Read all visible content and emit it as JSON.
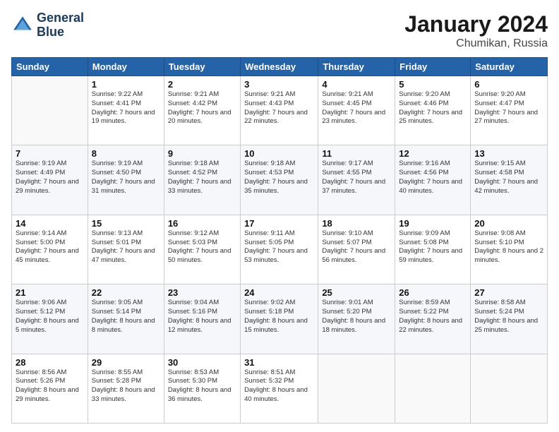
{
  "logo": {
    "line1": "General",
    "line2": "Blue"
  },
  "title": "January 2024",
  "subtitle": "Chumikan, Russia",
  "days_header": [
    "Sunday",
    "Monday",
    "Tuesday",
    "Wednesday",
    "Thursday",
    "Friday",
    "Saturday"
  ],
  "weeks": [
    [
      {
        "day": "",
        "sunrise": "",
        "sunset": "",
        "daylight": ""
      },
      {
        "day": "1",
        "sunrise": "Sunrise: 9:22 AM",
        "sunset": "Sunset: 4:41 PM",
        "daylight": "Daylight: 7 hours and 19 minutes."
      },
      {
        "day": "2",
        "sunrise": "Sunrise: 9:21 AM",
        "sunset": "Sunset: 4:42 PM",
        "daylight": "Daylight: 7 hours and 20 minutes."
      },
      {
        "day": "3",
        "sunrise": "Sunrise: 9:21 AM",
        "sunset": "Sunset: 4:43 PM",
        "daylight": "Daylight: 7 hours and 22 minutes."
      },
      {
        "day": "4",
        "sunrise": "Sunrise: 9:21 AM",
        "sunset": "Sunset: 4:45 PM",
        "daylight": "Daylight: 7 hours and 23 minutes."
      },
      {
        "day": "5",
        "sunrise": "Sunrise: 9:20 AM",
        "sunset": "Sunset: 4:46 PM",
        "daylight": "Daylight: 7 hours and 25 minutes."
      },
      {
        "day": "6",
        "sunrise": "Sunrise: 9:20 AM",
        "sunset": "Sunset: 4:47 PM",
        "daylight": "Daylight: 7 hours and 27 minutes."
      }
    ],
    [
      {
        "day": "7",
        "sunrise": "Sunrise: 9:19 AM",
        "sunset": "Sunset: 4:49 PM",
        "daylight": "Daylight: 7 hours and 29 minutes."
      },
      {
        "day": "8",
        "sunrise": "Sunrise: 9:19 AM",
        "sunset": "Sunset: 4:50 PM",
        "daylight": "Daylight: 7 hours and 31 minutes."
      },
      {
        "day": "9",
        "sunrise": "Sunrise: 9:18 AM",
        "sunset": "Sunset: 4:52 PM",
        "daylight": "Daylight: 7 hours and 33 minutes."
      },
      {
        "day": "10",
        "sunrise": "Sunrise: 9:18 AM",
        "sunset": "Sunset: 4:53 PM",
        "daylight": "Daylight: 7 hours and 35 minutes."
      },
      {
        "day": "11",
        "sunrise": "Sunrise: 9:17 AM",
        "sunset": "Sunset: 4:55 PM",
        "daylight": "Daylight: 7 hours and 37 minutes."
      },
      {
        "day": "12",
        "sunrise": "Sunrise: 9:16 AM",
        "sunset": "Sunset: 4:56 PM",
        "daylight": "Daylight: 7 hours and 40 minutes."
      },
      {
        "day": "13",
        "sunrise": "Sunrise: 9:15 AM",
        "sunset": "Sunset: 4:58 PM",
        "daylight": "Daylight: 7 hours and 42 minutes."
      }
    ],
    [
      {
        "day": "14",
        "sunrise": "Sunrise: 9:14 AM",
        "sunset": "Sunset: 5:00 PM",
        "daylight": "Daylight: 7 hours and 45 minutes."
      },
      {
        "day": "15",
        "sunrise": "Sunrise: 9:13 AM",
        "sunset": "Sunset: 5:01 PM",
        "daylight": "Daylight: 7 hours and 47 minutes."
      },
      {
        "day": "16",
        "sunrise": "Sunrise: 9:12 AM",
        "sunset": "Sunset: 5:03 PM",
        "daylight": "Daylight: 7 hours and 50 minutes."
      },
      {
        "day": "17",
        "sunrise": "Sunrise: 9:11 AM",
        "sunset": "Sunset: 5:05 PM",
        "daylight": "Daylight: 7 hours and 53 minutes."
      },
      {
        "day": "18",
        "sunrise": "Sunrise: 9:10 AM",
        "sunset": "Sunset: 5:07 PM",
        "daylight": "Daylight: 7 hours and 56 minutes."
      },
      {
        "day": "19",
        "sunrise": "Sunrise: 9:09 AM",
        "sunset": "Sunset: 5:08 PM",
        "daylight": "Daylight: 7 hours and 59 minutes."
      },
      {
        "day": "20",
        "sunrise": "Sunrise: 9:08 AM",
        "sunset": "Sunset: 5:10 PM",
        "daylight": "Daylight: 8 hours and 2 minutes."
      }
    ],
    [
      {
        "day": "21",
        "sunrise": "Sunrise: 9:06 AM",
        "sunset": "Sunset: 5:12 PM",
        "daylight": "Daylight: 8 hours and 5 minutes."
      },
      {
        "day": "22",
        "sunrise": "Sunrise: 9:05 AM",
        "sunset": "Sunset: 5:14 PM",
        "daylight": "Daylight: 8 hours and 8 minutes."
      },
      {
        "day": "23",
        "sunrise": "Sunrise: 9:04 AM",
        "sunset": "Sunset: 5:16 PM",
        "daylight": "Daylight: 8 hours and 12 minutes."
      },
      {
        "day": "24",
        "sunrise": "Sunrise: 9:02 AM",
        "sunset": "Sunset: 5:18 PM",
        "daylight": "Daylight: 8 hours and 15 minutes."
      },
      {
        "day": "25",
        "sunrise": "Sunrise: 9:01 AM",
        "sunset": "Sunset: 5:20 PM",
        "daylight": "Daylight: 8 hours and 18 minutes."
      },
      {
        "day": "26",
        "sunrise": "Sunrise: 8:59 AM",
        "sunset": "Sunset: 5:22 PM",
        "daylight": "Daylight: 8 hours and 22 minutes."
      },
      {
        "day": "27",
        "sunrise": "Sunrise: 8:58 AM",
        "sunset": "Sunset: 5:24 PM",
        "daylight": "Daylight: 8 hours and 25 minutes."
      }
    ],
    [
      {
        "day": "28",
        "sunrise": "Sunrise: 8:56 AM",
        "sunset": "Sunset: 5:26 PM",
        "daylight": "Daylight: 8 hours and 29 minutes."
      },
      {
        "day": "29",
        "sunrise": "Sunrise: 8:55 AM",
        "sunset": "Sunset: 5:28 PM",
        "daylight": "Daylight: 8 hours and 33 minutes."
      },
      {
        "day": "30",
        "sunrise": "Sunrise: 8:53 AM",
        "sunset": "Sunset: 5:30 PM",
        "daylight": "Daylight: 8 hours and 36 minutes."
      },
      {
        "day": "31",
        "sunrise": "Sunrise: 8:51 AM",
        "sunset": "Sunset: 5:32 PM",
        "daylight": "Daylight: 8 hours and 40 minutes."
      },
      {
        "day": "",
        "sunrise": "",
        "sunset": "",
        "daylight": ""
      },
      {
        "day": "",
        "sunrise": "",
        "sunset": "",
        "daylight": ""
      },
      {
        "day": "",
        "sunrise": "",
        "sunset": "",
        "daylight": ""
      }
    ]
  ]
}
